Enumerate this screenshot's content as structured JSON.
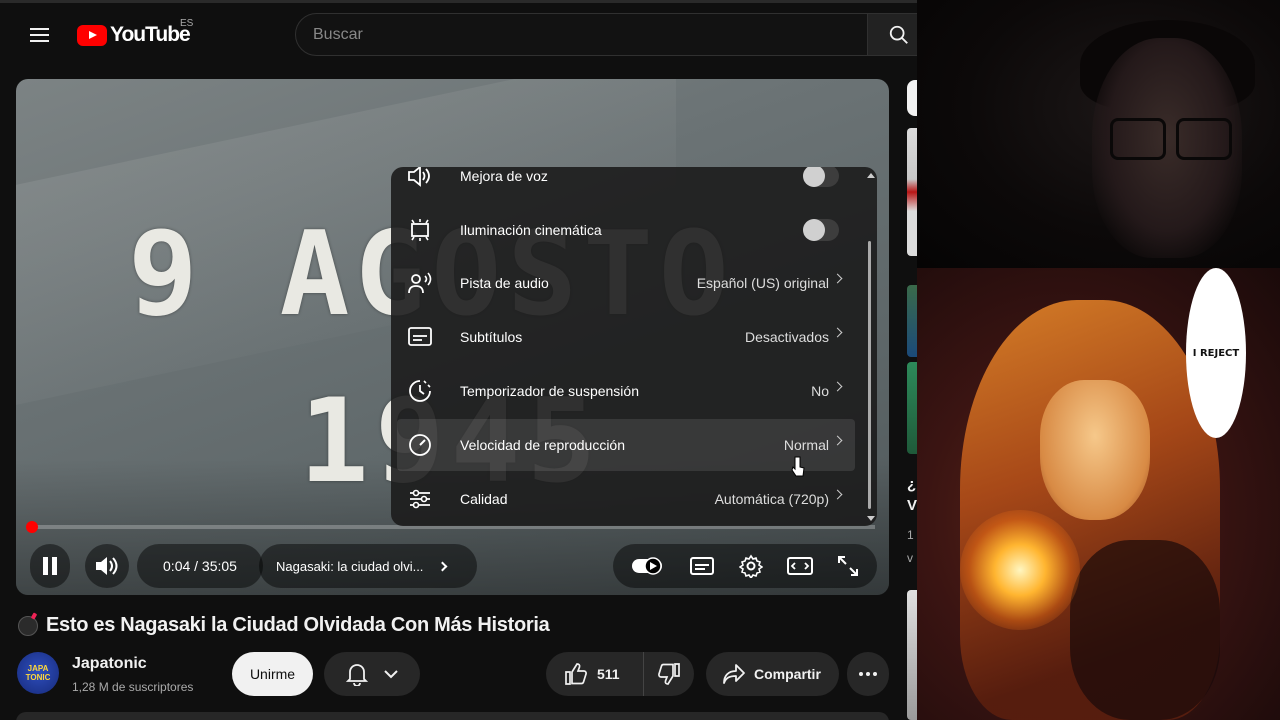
{
  "header": {
    "logo_text": "YouTube",
    "region": "ES",
    "search_placeholder": "Buscar"
  },
  "video": {
    "overlay_line1": "9 AGOSTO",
    "overlay_line2": "1945",
    "time_display": "0:04 / 35:05",
    "chapter": "Nagasaki: la ciudad olvi...",
    "progress_fraction": 0.002
  },
  "settings_menu": {
    "items": [
      {
        "label": "Mejora de voz",
        "type": "toggle",
        "value": "",
        "icon": "voice-boost-icon"
      },
      {
        "label": "Iluminación cinemática",
        "type": "toggle",
        "value": "",
        "icon": "ambient-mode-icon"
      },
      {
        "label": "Pista de audio",
        "type": "submenu",
        "value": "Español (US) original",
        "icon": "audio-track-icon"
      },
      {
        "label": "Subtítulos",
        "type": "submenu",
        "value": "Desactivados",
        "icon": "subtitles-icon"
      },
      {
        "label": "Temporizador de suspensión",
        "type": "submenu",
        "value": "No",
        "icon": "sleep-timer-icon"
      },
      {
        "label": "Velocidad de reproducción",
        "type": "submenu",
        "value": "Normal",
        "icon": "playback-speed-icon"
      },
      {
        "label": "Calidad",
        "type": "submenu",
        "value": "Automática (720p)",
        "icon": "quality-icon"
      }
    ]
  },
  "details": {
    "title": "Esto es Nagasaki la Ciudad Olvidada Con Más Historia",
    "channel_name": "Japatonic",
    "channel_avatar_text": "JAPA TONIC",
    "subscribers": "1,28 M de suscriptores",
    "join_label": "Unirme",
    "like_count": "511",
    "share_label": "Compartir"
  },
  "sidebar": {
    "snippet1": "¿",
    "snippet2": "V",
    "snippet3": "1",
    "snippet4": "v"
  },
  "overlay_art": {
    "speech_bubble": "I REJECT"
  },
  "colors": {
    "accent": "#ff0000",
    "background": "#0f0f0f",
    "surface": "#272727"
  }
}
